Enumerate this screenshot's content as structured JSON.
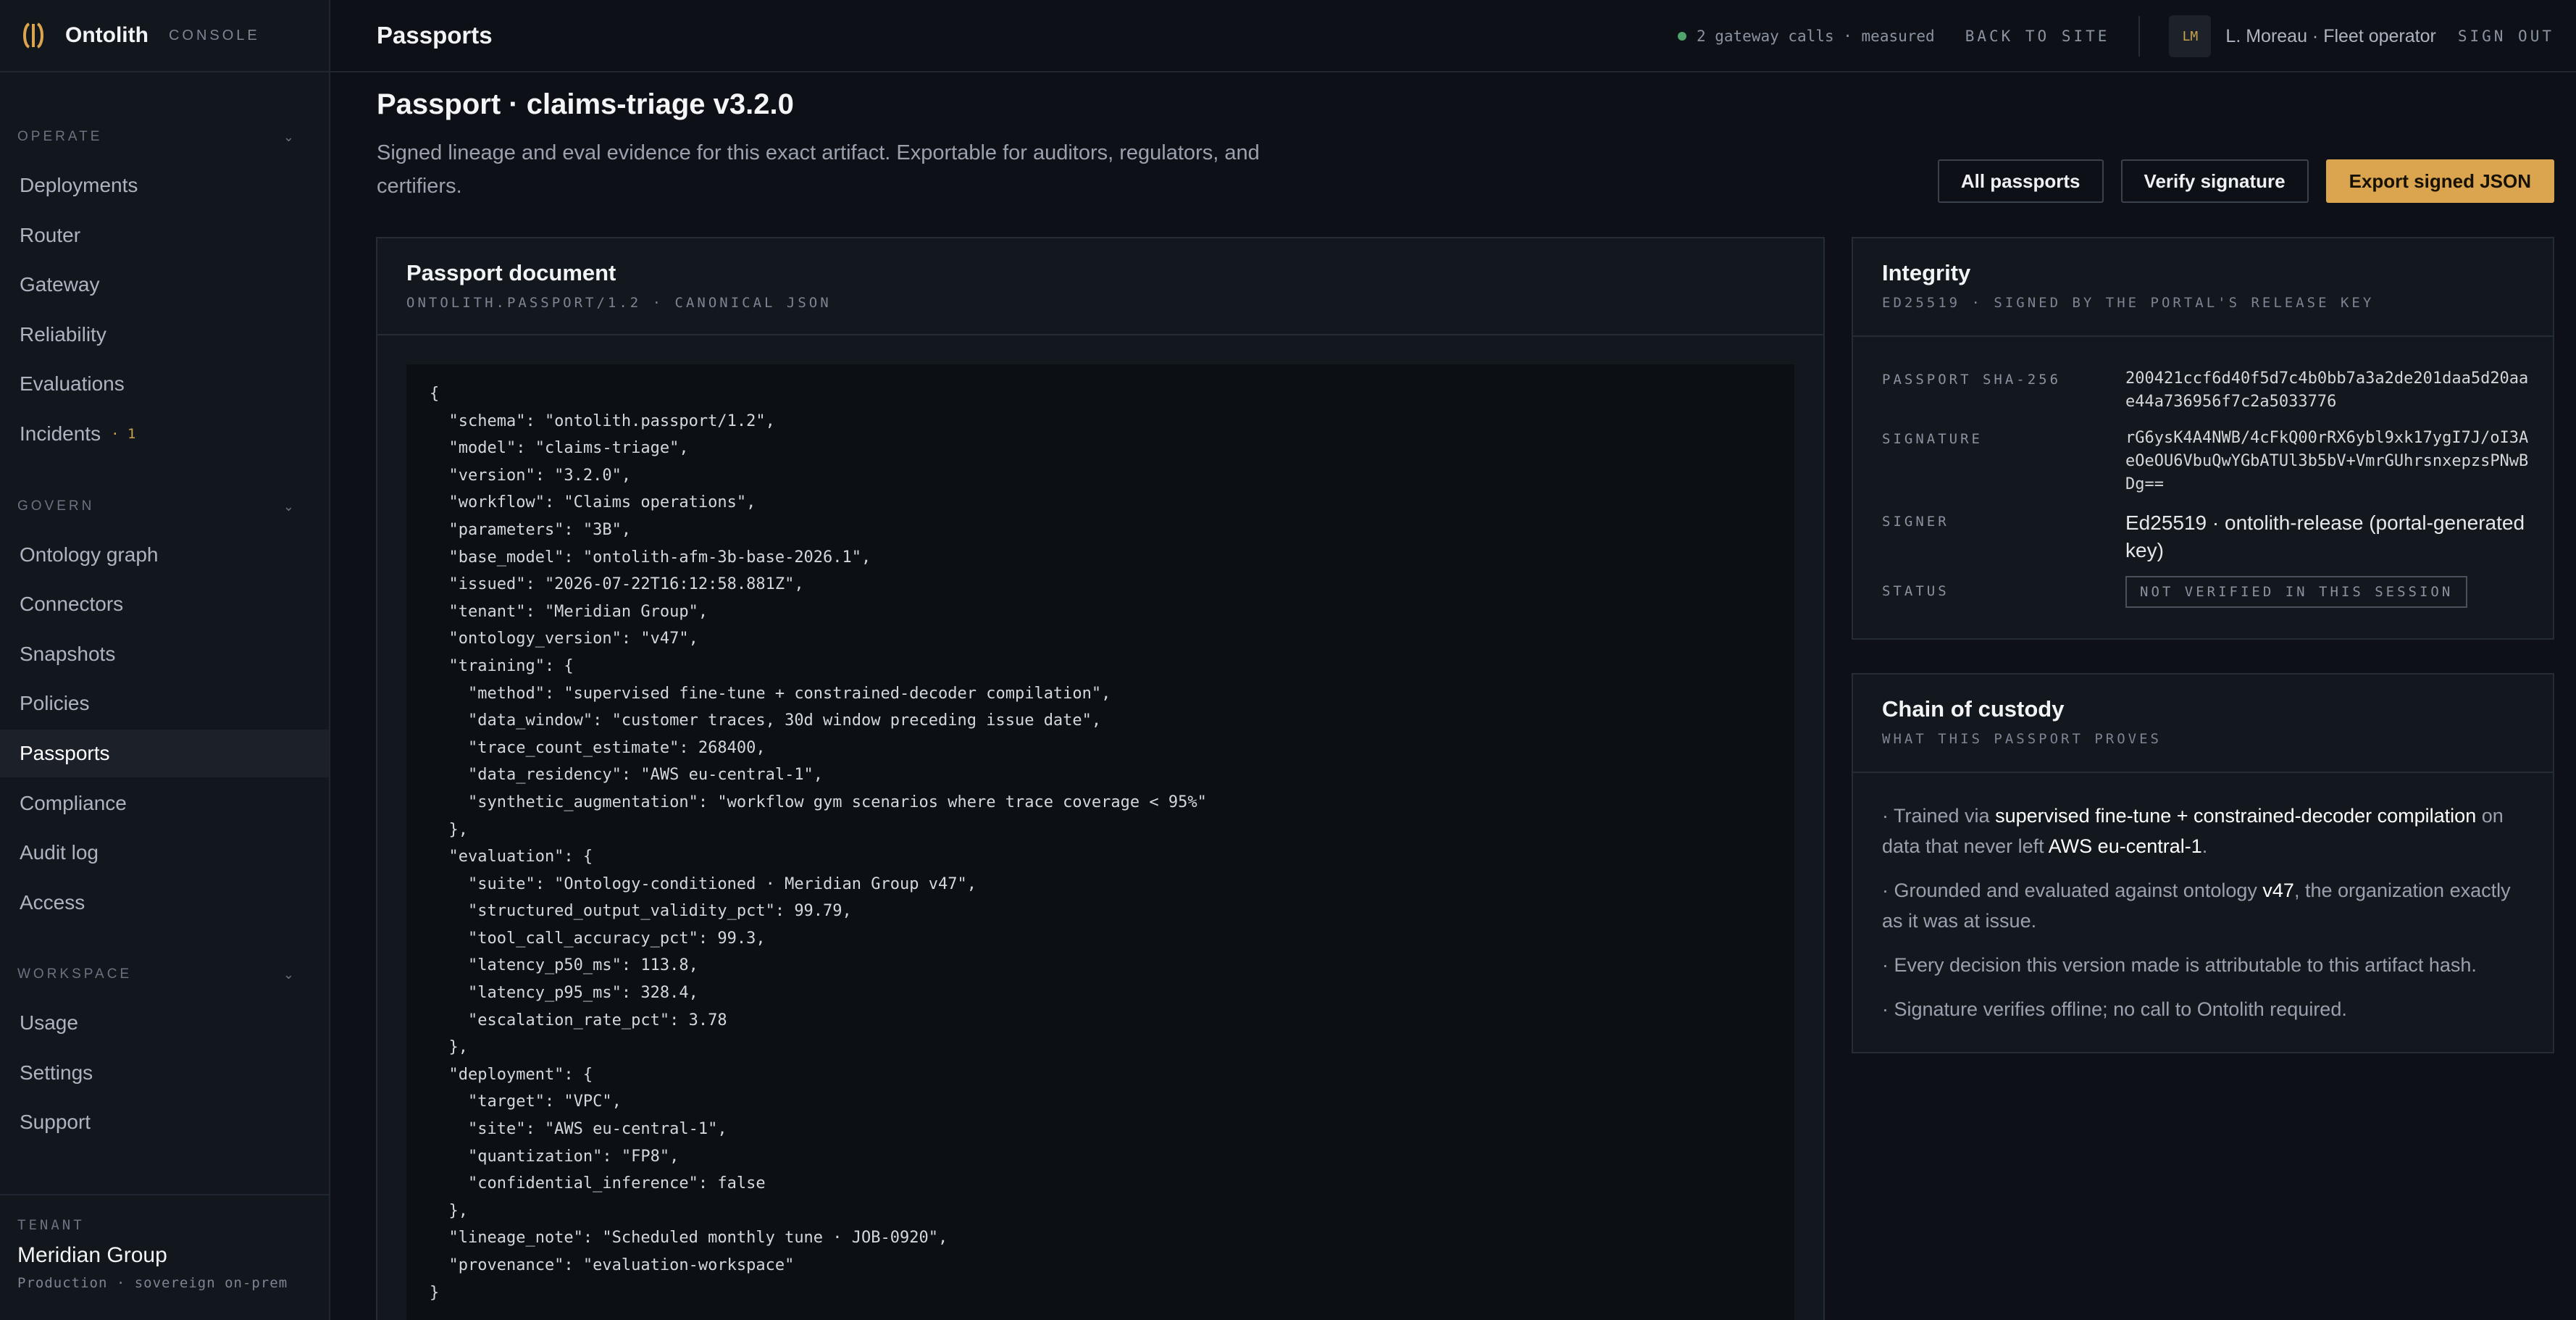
{
  "brand": {
    "name": "Ontolith",
    "sub": "CONSOLE"
  },
  "sidebar": {
    "sections": [
      {
        "label": "OPERATE",
        "items": [
          {
            "label": "Deployments"
          },
          {
            "label": "Router"
          },
          {
            "label": "Gateway"
          },
          {
            "label": "Reliability"
          },
          {
            "label": "Evaluations"
          },
          {
            "label": "Incidents",
            "badge": "· 1"
          }
        ]
      },
      {
        "label": "GOVERN",
        "items": [
          {
            "label": "Ontology graph"
          },
          {
            "label": "Connectors"
          },
          {
            "label": "Snapshots"
          },
          {
            "label": "Policies"
          },
          {
            "label": "Passports",
            "active": true
          },
          {
            "label": "Compliance"
          },
          {
            "label": "Audit log"
          },
          {
            "label": "Access"
          }
        ]
      },
      {
        "label": "WORKSPACE",
        "items": [
          {
            "label": "Usage"
          },
          {
            "label": "Settings"
          },
          {
            "label": "Support"
          }
        ]
      }
    ],
    "tenant": {
      "label": "TENANT",
      "name": "Meridian Group",
      "sub": "Production · sovereign on-prem"
    }
  },
  "topbar": {
    "title": "Passports",
    "gateway_status": "2 gateway calls · measured",
    "back_label": "BACK TO SITE",
    "avatar_initials": "LM",
    "user_label": "L. Moreau · Fleet operator",
    "signout_label": "SIGN OUT"
  },
  "page": {
    "title": "Passport · claims-triage v3.2.0",
    "description": "Signed lineage and eval evidence for this exact artifact. Exportable for auditors, regulators, and certifiers.",
    "actions": {
      "all": "All passports",
      "verify": "Verify signature",
      "export": "Export signed JSON"
    }
  },
  "document": {
    "title": "Passport document",
    "subtitle": "ONTOLITH.PASSPORT/1.2 · CANONICAL JSON",
    "lines": [
      "{",
      "  \"schema\": \"ontolith.passport/1.2\",",
      "  \"model\": \"claims-triage\",",
      "  \"version\": \"3.2.0\",",
      "  \"workflow\": \"Claims operations\",",
      "  \"parameters\": \"3B\",",
      "  \"base_model\": \"ontolith-afm-3b-base-2026.1\",",
      "  \"issued\": \"2026-07-22T16:12:58.881Z\",",
      "  \"tenant\": \"Meridian Group\",",
      "  \"ontology_version\": \"v47\",",
      "  \"training\": {",
      "    \"method\": \"supervised fine-tune + constrained-decoder compilation\",",
      "    \"data_window\": \"customer traces, 30d window preceding issue date\",",
      "    \"trace_count_estimate\": 268400,",
      "    \"data_residency\": \"AWS eu-central-1\",",
      "    \"synthetic_augmentation\": \"workflow gym scenarios where trace coverage < 95%\"",
      "  },",
      "  \"evaluation\": {",
      "    \"suite\": \"Ontology-conditioned · Meridian Group v47\",",
      "    \"structured_output_validity_pct\": 99.79,",
      "    \"tool_call_accuracy_pct\": 99.3,",
      "    \"latency_p50_ms\": 113.8,",
      "    \"latency_p95_ms\": 328.4,",
      "    \"escalation_rate_pct\": 3.78",
      "  },",
      "  \"deployment\": {",
      "    \"target\": \"VPC\",",
      "    \"site\": \"AWS eu-central-1\",",
      "    \"quantization\": \"FP8\",",
      "    \"confidential_inference\": false",
      "  },",
      "  \"lineage_note\": \"Scheduled monthly tune · JOB-0920\",",
      "  \"provenance\": \"evaluation-workspace\"",
      "}"
    ]
  },
  "integrity": {
    "title": "Integrity",
    "subtitle": "ED25519 · SIGNED BY THE PORTAL'S RELEASE KEY",
    "sha_label": "PASSPORT SHA-256",
    "sha_value": "200421ccf6d40f5d7c4b0bb7a3a2de201daa5d20aae44a736956f7c2a5033776",
    "sig_label": "SIGNATURE",
    "sig_value": "rG6ysK4A4NWB/4cFkQ00rRX6ybl9xk17ygI7J/oI3AeOeOU6VbuQwYGbATUl3b5bV+VmrGUhrsnxepzsPNwBDg==",
    "signer_label": "SIGNER",
    "signer_value": "Ed25519 · ontolith-release (portal-generated key)",
    "status_label": "STATUS",
    "status_value": "NOT VERIFIED IN THIS SESSION"
  },
  "chain": {
    "title": "Chain of custody",
    "subtitle": "WHAT THIS PASSPORT PROVES",
    "items": [
      {
        "a": "· Trained via ",
        "b": "supervised fine-tune + constrained-decoder compilation",
        "c": " on data that never left ",
        "d": "AWS eu-central-1",
        "e": "."
      },
      {
        "a": "· Grounded and evaluated against ontology ",
        "b": "v47",
        "c": ", the organization exactly as it was at issue."
      },
      {
        "a": "· Every decision this version made is attributable to this artifact hash."
      },
      {
        "a": "· Signature verifies offline; no call to Ontolith required."
      }
    ]
  },
  "colors": {
    "accent": "#dba44e",
    "background": "#0d1016",
    "status_ok": "#4fa36b"
  }
}
